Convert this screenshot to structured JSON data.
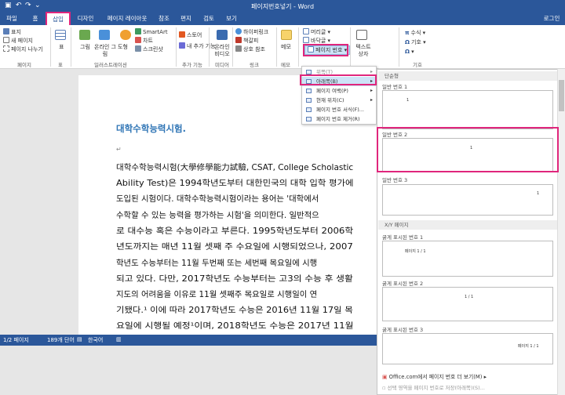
{
  "window": {
    "title": "페이지번호넣기 - Word",
    "login": "로그인"
  },
  "quick_access": {
    "undo": "↶",
    "redo": "↷",
    "customize": "⌄"
  },
  "tabs": [
    {
      "label": "파일"
    },
    {
      "label": "홈"
    },
    {
      "label": "삽입"
    },
    {
      "label": "디자인"
    },
    {
      "label": "페이지 레이아웃"
    },
    {
      "label": "참조"
    },
    {
      "label": "편지"
    },
    {
      "label": "검토"
    },
    {
      "label": "보기"
    }
  ],
  "ribbon": {
    "pages": {
      "cover": "표지",
      "blank": "새 페이지",
      "break": "페이지 나누기",
      "group": "페이지"
    },
    "tables": {
      "table": "표",
      "group": "표"
    },
    "illustrations": {
      "picture": "그림",
      "online_picture": "온라인 그림",
      "shapes": "도형",
      "smartart": "SmartArt",
      "chart": "차트",
      "screenshot": "스크린샷",
      "group": "일러스트레이션"
    },
    "addins": {
      "store": "스토어",
      "my_addins": "내 추가 기능",
      "group": "추가 기능"
    },
    "media": {
      "online_video": "온라인 비디오",
      "group": "미디어"
    },
    "links": {
      "hyperlink": "하이퍼링크",
      "bookmark": "책갈피",
      "cross_ref": "상호 참조",
      "group": "링크"
    },
    "comments": {
      "comment": "메모",
      "group": "메모"
    },
    "header_footer": {
      "header": "머리글",
      "footer": "바닥글",
      "page_number": "페이지 번호"
    },
    "text": {
      "textbox": "텍스트 상자"
    },
    "symbols": {
      "equation": "수식",
      "symbol": "기호",
      "group": "기호"
    }
  },
  "menu": {
    "items": [
      "위쪽(T)",
      "아래쪽(B)",
      "페이지 여백(P)",
      "현재 위치(C)",
      "페이지 번호 서식(F)...",
      "페이지 번호 제거(R)"
    ]
  },
  "gallery": {
    "section1": "단순형",
    "item1": "일반 번호 1",
    "item2": "일반 번호 2",
    "item3": "일반 번호 3",
    "section2": "X/Y 페이지",
    "item4": "굵게 표시된 번호 1",
    "item5": "굵게 표시된 번호 2",
    "item6": "굵게 표시된 번호 3",
    "pnum": "1",
    "xy": "페이지 1 / 1",
    "xy_short": "1 / 1",
    "more": "Office.com에서 페이지 번호 더 보기(M)",
    "save": "선택 영역을 페이지 번호로 저장(아래쪽)(S)..."
  },
  "document": {
    "heading": "대학수학능력시험.",
    "para_mark": "↵",
    "lines": [
      "대학수학능력시험(大學修學能力試驗, CSAT, College Scholastic",
      "Ability Test)은 1994학년도부터 대한민국의 대학 입학 평가에",
      "도입된 시험이다. 대학수학능력시험이라는 용어는 '대학에서",
      "수학할 수 있는 능력을 평가하는 시험'을 의미한다. 일반적으",
      "로 대수능 혹은 수능이라고 부른다. 1995학년도부터 2006학",
      "년도까지는 매년 11월 셋째 주 수요일에 시행되었으나, 2007",
      "학년도 수능부터는 11월 두번째 또는 세번째 목요일에 시행",
      "되고 있다. 다만, 2017학년도 수능부터는 고3의 수능 후 생활",
      "지도의 어려움을 이유로 11월 셋째주 목요일로 시행일이 연",
      "기됐다.¹ 이에 따라 2017학년도 수능은 2016년 11월 17일 목",
      "요일에 시행될 예정¹이며, 2018학년도 수능은 2017년 11월"
    ]
  },
  "status": {
    "page": "1/2 페이지",
    "words": "189개 단어",
    "lang": "한국어"
  }
}
